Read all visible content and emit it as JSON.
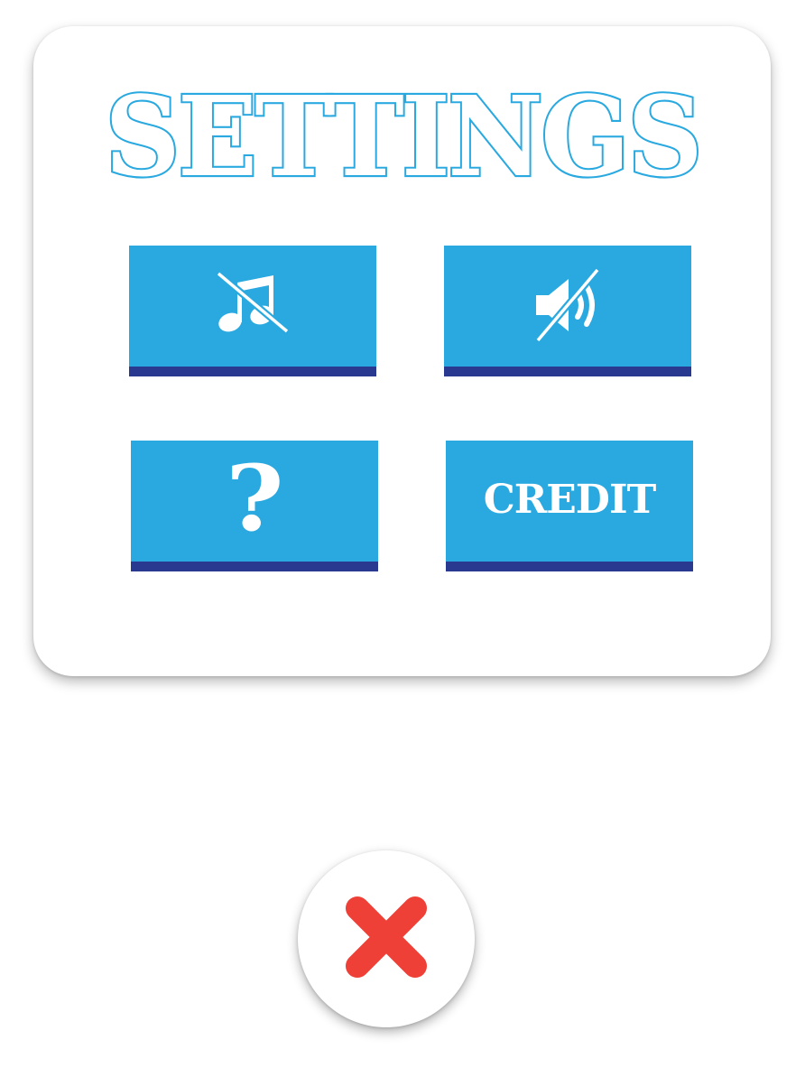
{
  "dialog": {
    "title": "SETTINGS"
  },
  "buttons": {
    "music": {
      "icon": "music-muted-icon"
    },
    "sound": {
      "icon": "speaker-muted-icon"
    },
    "help": {
      "label": "?"
    },
    "credit": {
      "label": "CREDIT"
    }
  },
  "close_button": {
    "icon": "close-x-icon"
  },
  "colors": {
    "button_fill": "#29a9e0",
    "button_shadow": "#2a3990",
    "title_outline": "#29a9e0",
    "close_x": "#ee4036"
  }
}
